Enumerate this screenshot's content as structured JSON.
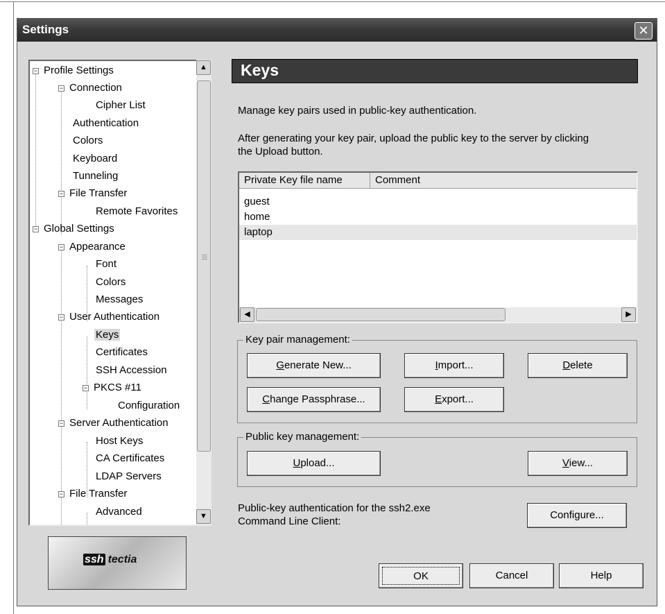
{
  "window": {
    "title": "Settings",
    "close_label": "✕"
  },
  "tree": {
    "items": [
      {
        "label": "Profile Settings"
      },
      {
        "label": "Connection"
      },
      {
        "label": "Cipher List"
      },
      {
        "label": "Authentication"
      },
      {
        "label": "Colors"
      },
      {
        "label": "Keyboard"
      },
      {
        "label": "Tunneling"
      },
      {
        "label": "File Transfer"
      },
      {
        "label": "Remote Favorites"
      },
      {
        "label": "Global Settings"
      },
      {
        "label": "Appearance"
      },
      {
        "label": "Font"
      },
      {
        "label": "Colors"
      },
      {
        "label": "Messages"
      },
      {
        "label": "User Authentication"
      },
      {
        "label": "Keys"
      },
      {
        "label": "Certificates"
      },
      {
        "label": "SSH Accession"
      },
      {
        "label": "PKCS #11"
      },
      {
        "label": "Configuration"
      },
      {
        "label": "Server Authentication"
      },
      {
        "label": "Host Keys"
      },
      {
        "label": "CA Certificates"
      },
      {
        "label": "LDAP Servers"
      },
      {
        "label": "File Transfer"
      },
      {
        "label": "Advanced"
      }
    ],
    "selected": "Keys"
  },
  "logo": {
    "part1": "ssh",
    "part2": "tectia"
  },
  "panel": {
    "title": "Keys",
    "desc1": "Manage key pairs used in public-key authentication.",
    "desc2_line1": "After generating your key pair, upload the public key to the server by clicking",
    "desc2_line2": "the Upload button.",
    "list": {
      "columns": [
        "Private Key file name",
        "Comment"
      ],
      "rows": [
        "guest",
        "home",
        "laptop"
      ],
      "selected_row": "laptop"
    },
    "key_pair_group": {
      "label": "Key pair management:",
      "generate": {
        "pre": "",
        "u": "G",
        "post": "enerate New..."
      },
      "import": {
        "pre": "",
        "u": "I",
        "post": "mport..."
      },
      "delete": {
        "pre": "",
        "u": "D",
        "post": "elete"
      },
      "change": {
        "pre": "",
        "u": "C",
        "post": "hange Passphrase..."
      },
      "export": {
        "pre": "",
        "u": "E",
        "post": "xport..."
      }
    },
    "public_key_group": {
      "label": "Public key management:",
      "upload": {
        "pre": "",
        "u": "U",
        "post": "pload..."
      },
      "view": {
        "pre": "",
        "u": "V",
        "post": "iew..."
      }
    },
    "cli_line1": "Public-key authentication for the ssh2.exe",
    "cli_line2": "Command Line Client:",
    "configure": "Configure..."
  },
  "footer": {
    "ok": "OK",
    "cancel": "Cancel",
    "help": "Help"
  }
}
